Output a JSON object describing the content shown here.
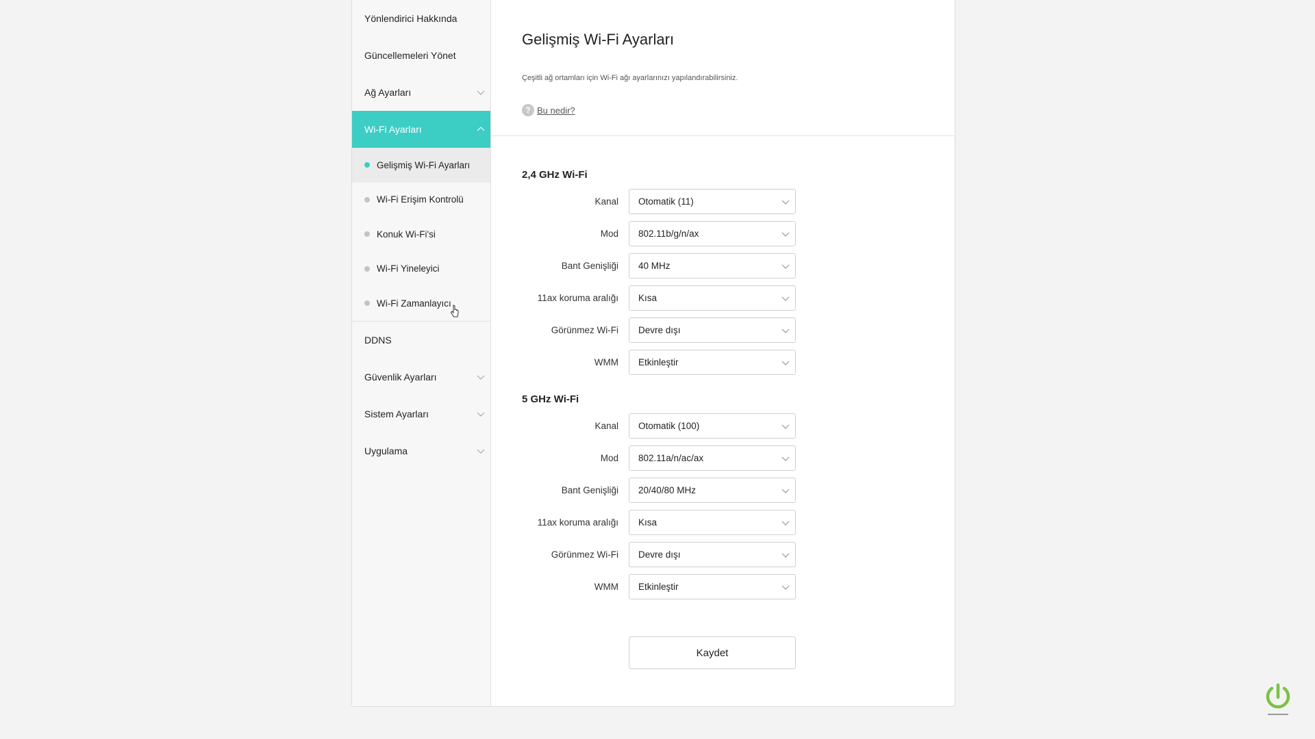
{
  "sidebar": {
    "items": [
      {
        "label": "Yönlendirici Hakkında"
      },
      {
        "label": "Güncellemeleri Yönet"
      },
      {
        "label": "Ağ Ayarları"
      },
      {
        "label": "Wi-Fi Ayarları"
      },
      {
        "label": "DDNS"
      },
      {
        "label": "Güvenlik Ayarları"
      },
      {
        "label": "Sistem Ayarları"
      },
      {
        "label": "Uygulama"
      }
    ],
    "wifi_sub_items": [
      {
        "label": "Gelişmiş Wi-Fi Ayarları"
      },
      {
        "label": "Wi-Fi Erişim Kontrolü"
      },
      {
        "label": "Konuk Wi-Fi'si"
      },
      {
        "label": "Wi-Fi Yineleyici"
      },
      {
        "label": "Wi-Fi Zamanlayıcı"
      }
    ]
  },
  "page": {
    "title": "Gelişmiş Wi-Fi Ayarları",
    "description": "Çeşitli ağ ortamları için Wi-Fi ağı ayarlarınızı yapılandırabilirsiniz.",
    "help_label": "Bu nedir?"
  },
  "band_24": {
    "title": "2,4 GHz Wi-Fi",
    "fields": [
      {
        "label": "Kanal",
        "value": "Otomatik (11)"
      },
      {
        "label": "Mod",
        "value": "802.11b/g/n/ax"
      },
      {
        "label": "Bant Genişliği",
        "value": "40 MHz"
      },
      {
        "label": "11ax koruma aralığı",
        "value": "Kısa"
      },
      {
        "label": "Görünmez Wi-Fi",
        "value": "Devre dışı"
      },
      {
        "label": "WMM",
        "value": "Etkinleştir"
      }
    ]
  },
  "band_5": {
    "title": "5 GHz Wi-Fi",
    "fields": [
      {
        "label": "Kanal",
        "value": "Otomatik (100)"
      },
      {
        "label": "Mod",
        "value": "802.11a/n/ac/ax"
      },
      {
        "label": "Bant Genişliği",
        "value": "20/40/80 MHz"
      },
      {
        "label": "11ax koruma aralığı",
        "value": "Kısa"
      },
      {
        "label": "Görünmez Wi-Fi",
        "value": "Devre dışı"
      },
      {
        "label": "WMM",
        "value": "Etkinleştir"
      }
    ]
  },
  "actions": {
    "save_label": "Kaydet"
  },
  "colors": {
    "accent": "#3ccdc4",
    "logo": "#7cc242"
  },
  "icons": {
    "expand": "chevron-down-icon",
    "collapse": "chevron-up-icon",
    "help": "question-circle-icon",
    "logo": "power-icon"
  }
}
